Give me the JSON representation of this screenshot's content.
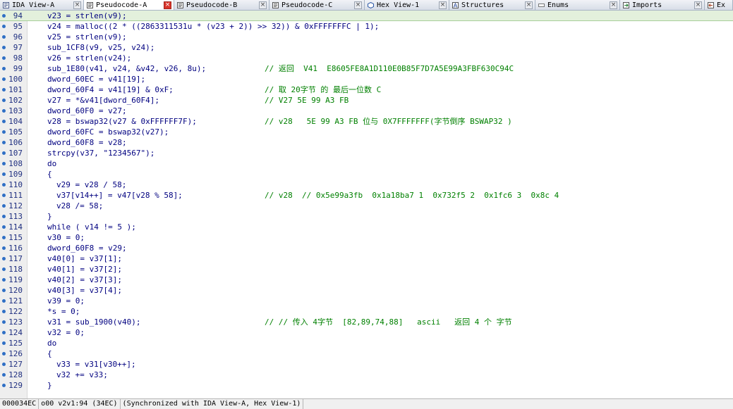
{
  "tabs": [
    {
      "label": "IDA View-A",
      "icon": "ida-view-icon",
      "active": false,
      "width": 119
    },
    {
      "label": "Pseudocode-A",
      "icon": "pseudocode-icon",
      "active": true,
      "width": 128
    },
    {
      "label": "Pseudocode-B",
      "icon": "pseudocode-icon",
      "active": false,
      "width": 135
    },
    {
      "label": "Pseudocode-C",
      "icon": "pseudocode-icon",
      "active": false,
      "width": 135
    },
    {
      "label": "Hex View-1",
      "icon": "hex-view-icon",
      "active": false,
      "width": 120
    },
    {
      "label": "Structures",
      "icon": "structures-icon",
      "active": false,
      "width": 122
    },
    {
      "label": "Enums",
      "icon": "enums-icon",
      "active": false,
      "width": 120
    },
    {
      "label": "Imports",
      "icon": "imports-icon",
      "active": false,
      "width": 120
    },
    {
      "label": "Ex",
      "icon": "exports-icon",
      "active": false,
      "width": 40
    }
  ],
  "tab_close_glyph": "×",
  "code_lines": [
    {
      "num": "94",
      "text": "v23 = strlen(v9);",
      "comment": "",
      "current": true
    },
    {
      "num": "95",
      "text": "v24 = malloc((2 * ((2863311531u * (v23 + 2)) >> 32)) & 0xFFFFFFFC | 1);",
      "comment": ""
    },
    {
      "num": "96",
      "text": "v25 = strlen(v9);",
      "comment": ""
    },
    {
      "num": "97",
      "text": "sub_1CF8(v9, v25, v24);",
      "comment": ""
    },
    {
      "num": "98",
      "text": "v26 = strlen(v24);",
      "comment": ""
    },
    {
      "num": "99",
      "text": "sub_1E80(v41, v24, &v42, v26, 8u);",
      "comment": "// 返回  V41  E8605FE8A1D110E0B85F7D7A5E99A3FBF630C94C"
    },
    {
      "num": "100",
      "text": "dword_60EC = v41[19];",
      "comment": ""
    },
    {
      "num": "101",
      "text": "dword_60F4 = v41[19] & 0xF;",
      "comment": "// 取 20字节 的 最后一位数 C"
    },
    {
      "num": "102",
      "text": "v27 = *&v41[dword_60F4];",
      "comment": "// V27 5E 99 A3 FB"
    },
    {
      "num": "103",
      "text": "dword_60F0 = v27;",
      "comment": ""
    },
    {
      "num": "104",
      "text": "v28 = bswap32(v27 & 0xFFFFFF7F);",
      "comment": "// v28   5E 99 A3 FB 位与 0X7FFFFFFF(字节倒序 BSWAP32 )"
    },
    {
      "num": "105",
      "text": "dword_60FC = bswap32(v27);",
      "comment": ""
    },
    {
      "num": "106",
      "text": "dword_60F8 = v28;",
      "comment": ""
    },
    {
      "num": "107",
      "text": "strcpy(v37, \"1234567\");",
      "comment": ""
    },
    {
      "num": "108",
      "text": "do",
      "comment": ""
    },
    {
      "num": "109",
      "text": "{",
      "comment": ""
    },
    {
      "num": "110",
      "text": "v29 = v28 / 58;",
      "comment": "",
      "indent": 1
    },
    {
      "num": "111",
      "text": "v37[v14++] = v47[v28 % 58];",
      "comment": "// v28  // 0x5e99a3fb  0x1a18ba7 1  0x732f5 2  0x1fc6 3  0x8c 4",
      "indent": 1
    },
    {
      "num": "112",
      "text": "v28 /= 58;",
      "comment": "",
      "indent": 1
    },
    {
      "num": "113",
      "text": "}",
      "comment": ""
    },
    {
      "num": "114",
      "text": "while ( v14 != 5 );",
      "comment": ""
    },
    {
      "num": "115",
      "text": "v30 = 0;",
      "comment": ""
    },
    {
      "num": "116",
      "text": "dword_60F8 = v29;",
      "comment": ""
    },
    {
      "num": "117",
      "text": "v40[0] = v37[1];",
      "comment": ""
    },
    {
      "num": "118",
      "text": "v40[1] = v37[2];",
      "comment": ""
    },
    {
      "num": "119",
      "text": "v40[2] = v37[3];",
      "comment": ""
    },
    {
      "num": "120",
      "text": "v40[3] = v37[4];",
      "comment": ""
    },
    {
      "num": "121",
      "text": "v39 = 0;",
      "comment": ""
    },
    {
      "num": "122",
      "text": "*s = 0;",
      "comment": ""
    },
    {
      "num": "123",
      "text": "v31 = sub_1900(v40);",
      "comment": "// // 传入 4字节  [82,89,74,88]   ascii   返回 4 个 字节"
    },
    {
      "num": "124",
      "text": "v32 = 0;",
      "comment": ""
    },
    {
      "num": "125",
      "text": "do",
      "comment": ""
    },
    {
      "num": "126",
      "text": "{",
      "comment": ""
    },
    {
      "num": "127",
      "text": "v33 = v31[v30++];",
      "comment": "",
      "indent": 1
    },
    {
      "num": "128",
      "text": "v32 += v33;",
      "comment": "",
      "indent": 1
    },
    {
      "num": "129",
      "text": "}",
      "comment": ""
    }
  ],
  "status": {
    "address": "000034EC",
    "location": "o00 v2v1:94 (34EC)",
    "sync": "(Synchronized with IDA View-A, Hex View-1)"
  },
  "colors": {
    "code": "#000080",
    "comment": "#008000",
    "line_number": "#1f2f80",
    "current_line": "#e3f0dc",
    "close_active": "#d9342b"
  }
}
